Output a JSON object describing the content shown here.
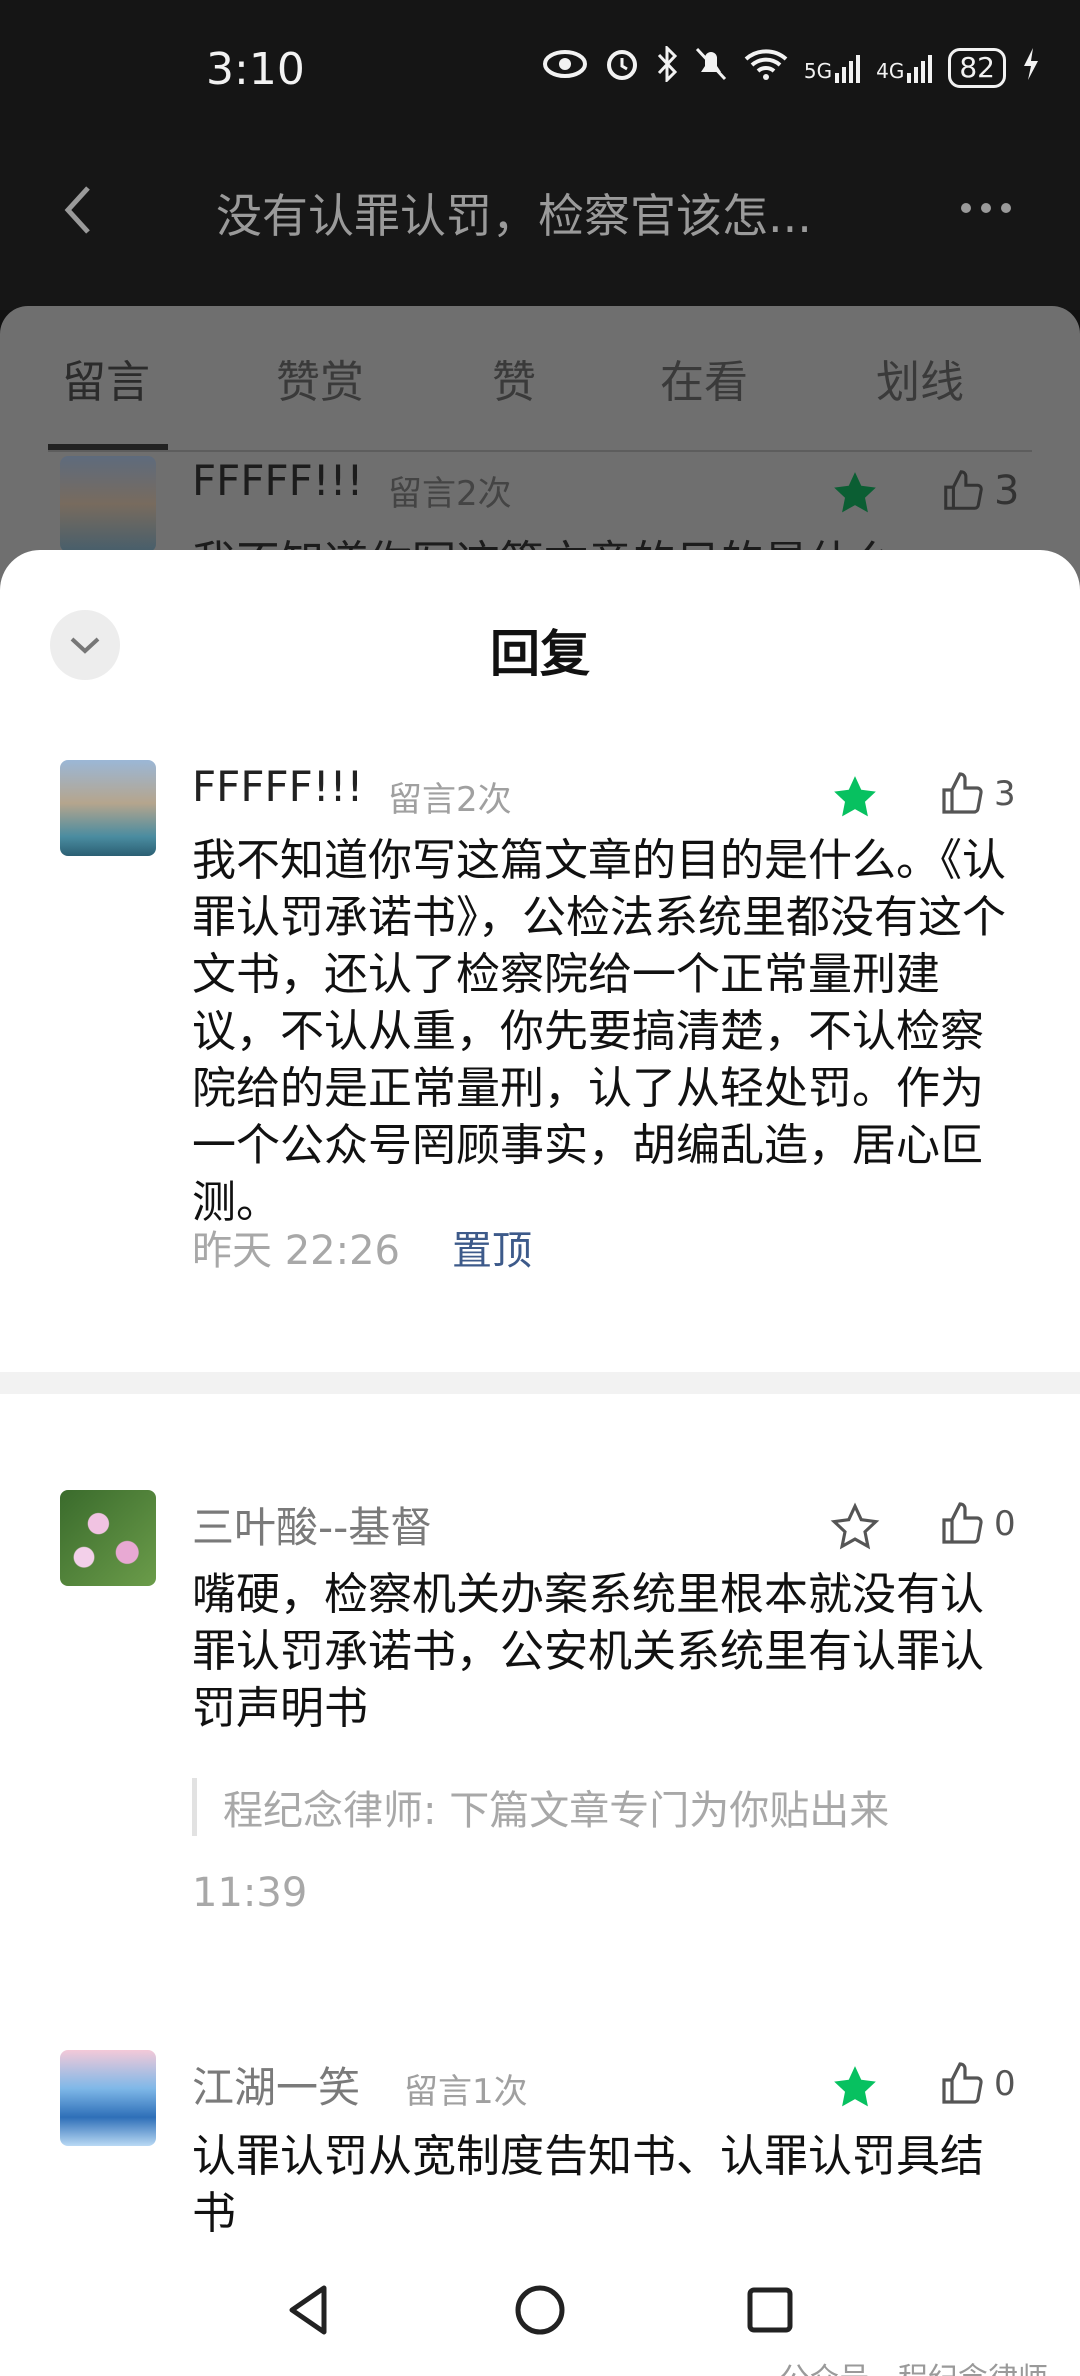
{
  "status_bar": {
    "time": "3:10",
    "signal_5g": "5G",
    "signal_4g": "4G",
    "battery": "82"
  },
  "header": {
    "article_title": "没有认罪认罚，检察官该怎..."
  },
  "tabs": [
    {
      "label": "留言"
    },
    {
      "label": "赞赏"
    },
    {
      "label": "赞"
    },
    {
      "label": "在看"
    },
    {
      "label": "划线"
    }
  ],
  "background_comment": {
    "name": "FFFFF!!!",
    "badge": "留言2次",
    "likes": "3",
    "content_preview": "我不知道你写这篇文章的目的是什么"
  },
  "reply_sheet": {
    "title": "回复"
  },
  "comments": [
    {
      "name": "FFFFF!!!",
      "badge": "留言2次",
      "starred": true,
      "likes": "3",
      "content": "我不知道你写这篇文章的目的是什么。《认罪认罚承诺书》，公检法系统里都没有这个文书，还认了检察院给一个正常量刑建议，不认从重，你先要搞清楚，不认检察院给的是正常量刑，认了从轻处罚。作为一个公众号罔顾事实，胡编乱造，居心叵测。",
      "time": "昨天 22:26",
      "pin_label": "置顶"
    },
    {
      "name": "三叶酸--基督",
      "badge": "",
      "starred": false,
      "likes": "0",
      "content": "嘴硬，检察机关办案系统里根本就没有认罪认罚承诺书，公安机关系统里有认罪认罚声明书",
      "author_reply": "程纪念律师: 下篇文章专门为你贴出来",
      "time": "11:39"
    },
    {
      "name": "江湖一笑",
      "badge": "留言1次",
      "starred": true,
      "likes": "0",
      "content": "认罪认罚从宽制度告知书、认罪认罚具结书"
    }
  ],
  "watermark": "公众号 · 程纪念律师",
  "colors": {
    "star_green": "#07c160",
    "pin_blue": "#3d5a8a",
    "text_gray": "#a8a8a8"
  }
}
